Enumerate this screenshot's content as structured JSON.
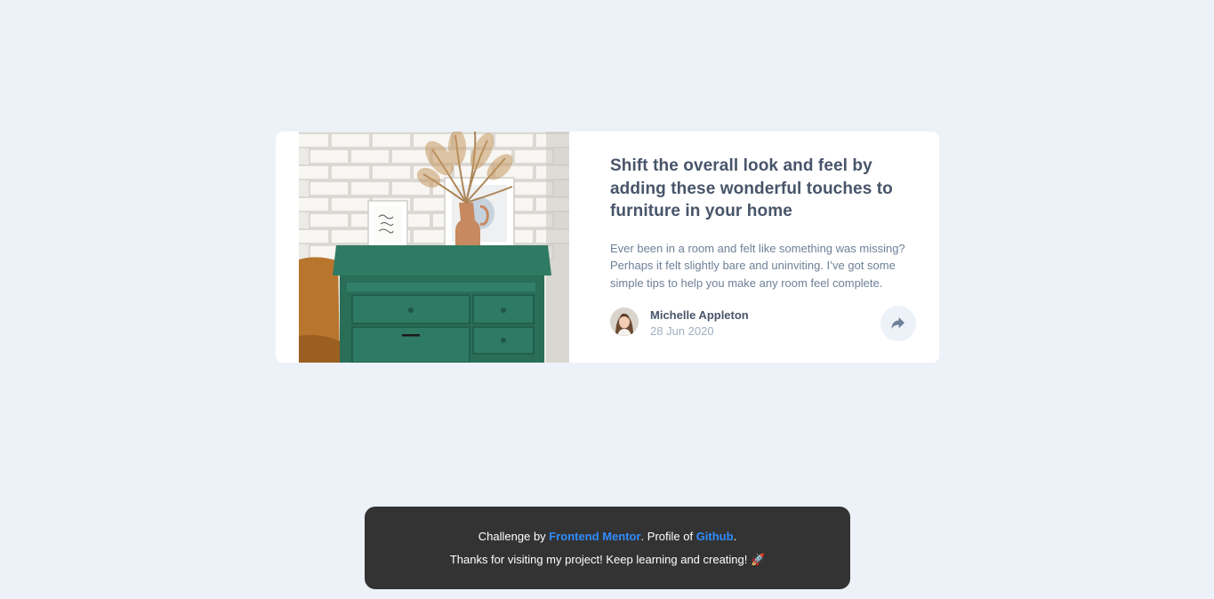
{
  "card": {
    "image_alt": "drawers",
    "headline": "Shift the overall look and feel by adding these wonderful touches to furniture in your home",
    "excerpt": "Ever been in a room and felt like something was missing? Perhaps it felt slightly bare and uninviting. I’ve got some simple tips to help you make any room feel complete.",
    "author": {
      "name": "Michelle Appleton",
      "date": "28 Jun 2020"
    },
    "share_icon": "share-icon"
  },
  "attribution": {
    "prefix": "Challenge by ",
    "frontend_mentor_label": "Frontend Mentor",
    "middle": ". Profile of ",
    "github_label": "Github",
    "suffix": ".",
    "thanks": "Thanks for visiting my project! Keep learning and creating! 🚀"
  },
  "colors": {
    "background": "#ecf2f8",
    "heading": "#48556a",
    "body_text": "#6e8098",
    "muted": "#9eafc2",
    "link": "#2f8cff",
    "footer_bg": "#333333"
  }
}
